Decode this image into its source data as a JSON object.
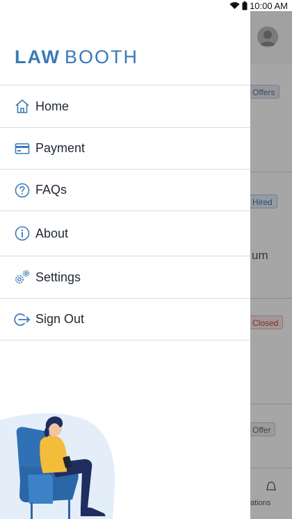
{
  "status_bar": {
    "time": "10:00 AM"
  },
  "brand": {
    "part1": "LAW",
    "part2": "BOOTH"
  },
  "menu": [
    {
      "label": "Home",
      "icon": "home-icon"
    },
    {
      "label": "Payment",
      "icon": "credit-card-icon"
    },
    {
      "label": "FAQs",
      "icon": "question-circle-icon"
    },
    {
      "label": "About",
      "icon": "info-circle-icon"
    },
    {
      "label": "Settings",
      "icon": "gears-icon"
    },
    {
      "label": "Sign Out",
      "icon": "sign-out-icon"
    }
  ],
  "background": {
    "badges": [
      "Offers",
      "Hired",
      "Closed",
      "Offer"
    ],
    "partial_text": "um",
    "bottom_nav_partial_label": "ations"
  },
  "colors": {
    "accent": "#3b79b8",
    "text": "#1f2733",
    "divider": "#dcdcdc"
  }
}
